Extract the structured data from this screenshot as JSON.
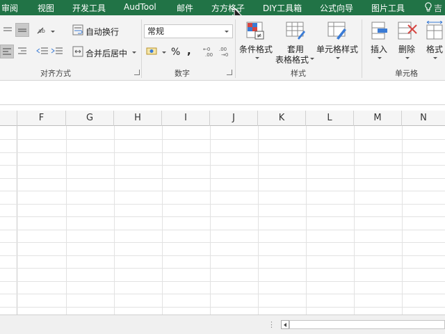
{
  "tabs": [
    "审阅",
    "视图",
    "开发工具",
    "AudTool",
    "邮件",
    "方方格子",
    "DIY工具箱",
    "公式向导",
    "图片工具"
  ],
  "help_label": "吉",
  "alignment": {
    "wrap_text": "自动换行",
    "merge_center": "合并后居中",
    "group_label": "对齐方式"
  },
  "number": {
    "format_value": "常规",
    "percent": "%",
    "comma": ",",
    "group_label": "数字"
  },
  "styles": {
    "conditional_formatting": "条件格式",
    "format_as_table_line1": "套用",
    "format_as_table_line2": "表格格式",
    "cell_styles": "单元格样式",
    "group_label": "样式"
  },
  "cells": {
    "insert": "插入",
    "delete": "删除",
    "format": "格式",
    "group_label": "单元格"
  },
  "columns": [
    "F",
    "G",
    "H",
    "I",
    "J",
    "K",
    "L",
    "M",
    "N"
  ],
  "status": {
    "dots": "⋮"
  },
  "colors": {
    "accent": "#217346"
  }
}
